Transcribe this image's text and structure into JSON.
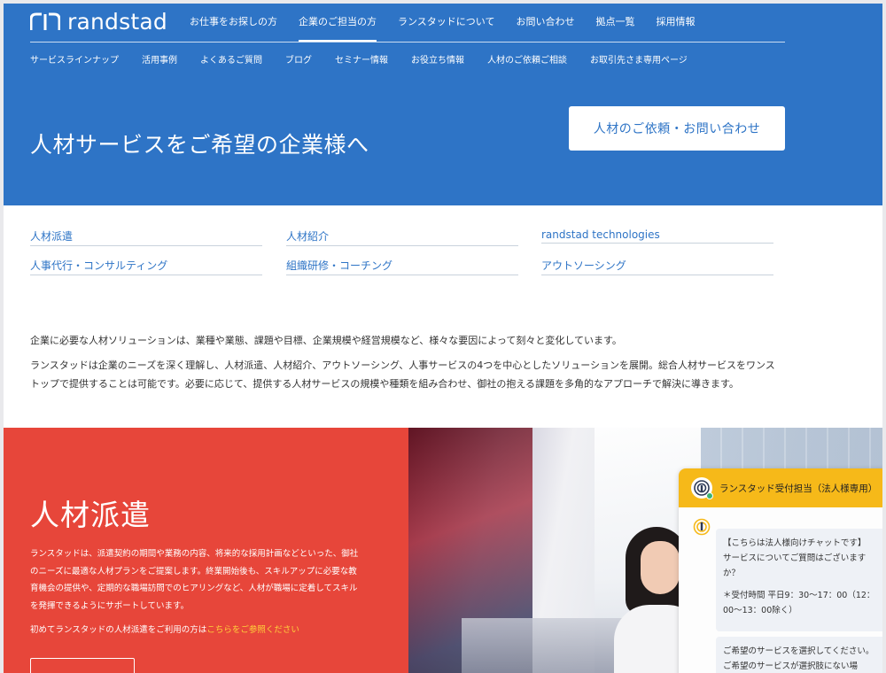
{
  "brand": {
    "name": "randstad"
  },
  "colors": {
    "primary": "#2e74c6",
    "accent_red": "#e7463a",
    "chat_yellow": "#f6b919",
    "link_yellow": "#ffd23a"
  },
  "nav": {
    "main": [
      "お仕事をお探しの方",
      "企業のご担当の方",
      "ランスタッドについて",
      "お問い合わせ",
      "拠点一覧",
      "採用情報"
    ],
    "active": "企業のご担当の方",
    "sub": [
      "サービスラインナップ",
      "活用事例",
      "よくあるご質問",
      "ブログ",
      "セミナー情報",
      "お役立ち情報",
      "人材のご依頼ご相談",
      "お取引先さま専用ページ"
    ]
  },
  "hero": {
    "title": "人材サービスをご希望の企業様へ",
    "cta": "人材のご依頼・お問い合わせ"
  },
  "services": [
    "人材派遣",
    "人材紹介",
    "randstad technologies",
    "人事代行・コンサルティング",
    "組織研修・コーチング",
    "アウトソーシング"
  ],
  "intro": {
    "p1": "企業に必要な人材ソリューションは、業種や業態、課題や目標、企業規模や経営規模など、様々な要因によって刻々と変化しています。",
    "p2": "ランスタッドは企業のニーズを深く理解し、人材派遣、人材紹介、アウトソーシング、人事サービスの4つを中心としたソリューションを展開。総合人材サービスをワンストップで提供することは可能です。必要に応じて、提供する人材サービスの規模や種類を組み合わせ、御社の抱える課題を多角的なアプローチで解決に導きます。"
  },
  "feature": {
    "title": "人材派遣",
    "body": "ランスタッドは、派遣契約の期間や業務の内容、将来的な採用計画などといった、御社のニーズに最適な人材プランをご提案します。終業開始後も、スキルアップに必要な教育機会の提供や、定期的な職場訪問でのヒアリングなど、人材が職場に定着してスキルを発揮できるようにサポートしています。",
    "first_time_text": "初めてランスタッドの人材派遣をご利用の方は",
    "first_time_link": "こちらをご参照ください"
  },
  "chat": {
    "title": "ランスタッド受付担当（法人様専用）",
    "msg1_line1": "【こちらは法人様向けチャットです】",
    "msg1_line2": "サービスについてご質問はございますか？",
    "msg1_line3": "＊受付時間 平日9：30〜17：00（12：00〜13：00除く）",
    "msg2_line1": "ご希望のサービスを選択してください。",
    "msg2_line2": "ご希望のサービスが選択肢にない場"
  }
}
